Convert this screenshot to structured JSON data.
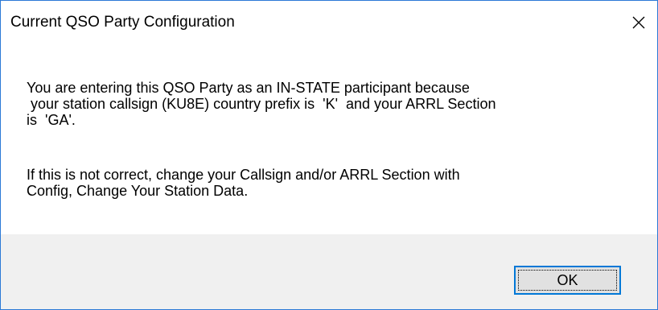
{
  "window": {
    "title": "Current QSO Party Configuration",
    "close_icon": "close-icon"
  },
  "message": {
    "paragraph1_lines": [
      "You are entering this QSO Party as an IN-STATE participant because",
      " your station callsign (KU8E) country prefix is  'K'  and your ARRL Section",
      "is  'GA'."
    ],
    "paragraph2_lines": [
      "If this is not correct, change your Callsign and/or ARRL Section with",
      "Config, Change Your Station Data."
    ]
  },
  "buttons": {
    "ok_label": "OK"
  },
  "colors": {
    "window_border": "#2b79d6",
    "footer_background": "#f0f0f0",
    "button_face": "#e1e1e1",
    "button_focus_border": "#0078d7"
  }
}
